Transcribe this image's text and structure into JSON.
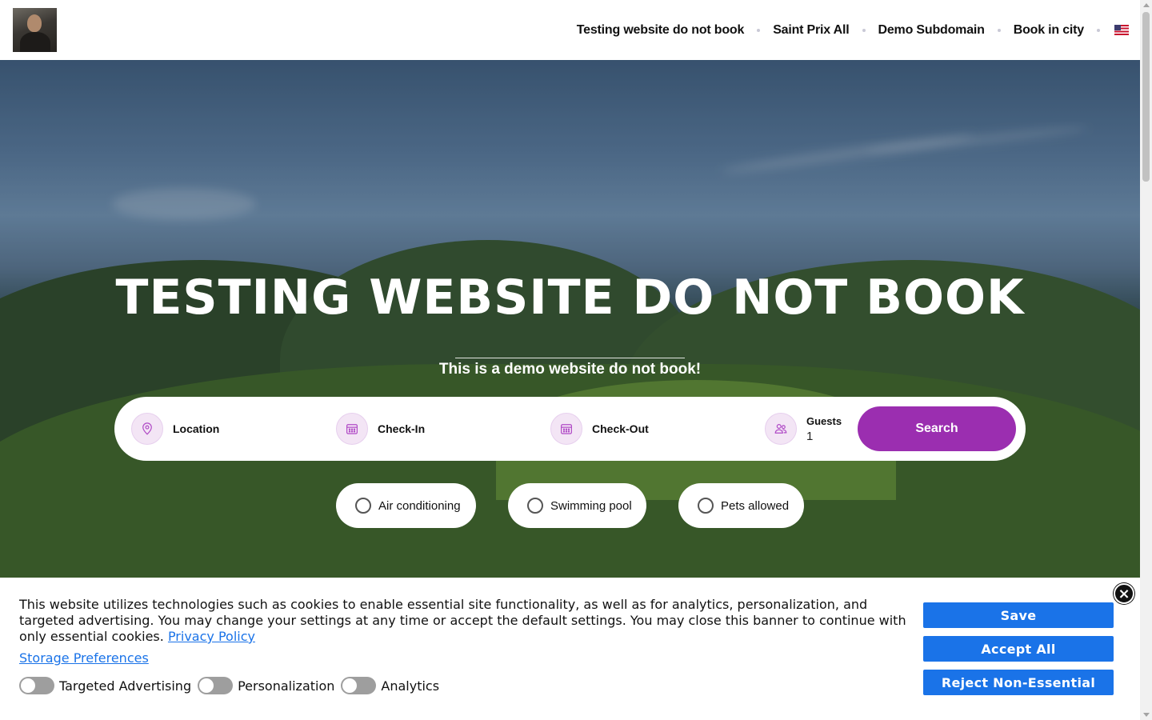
{
  "header": {
    "nav": [
      "Testing website do not book",
      "Saint Prix All",
      "Demo Subdomain",
      "Book in city"
    ],
    "language_icon": "us-flag-icon"
  },
  "hero": {
    "title": "TESTING WEBSITE DO NOT BOOK",
    "subtitle": "This is a demo website do not book!"
  },
  "search": {
    "location_label": "Location",
    "checkin_label": "Check-In",
    "checkout_label": "Check-Out",
    "guests_label": "Guests",
    "guests_value": "1",
    "button_label": "Search",
    "accent_color": "#9b2eb0"
  },
  "amenities": [
    "Air conditioning",
    "Swimming pool",
    "Pets allowed"
  ],
  "cookie_banner": {
    "text": "This website utilizes technologies such as cookies to enable essential site functionality, as well as for analytics, personalization, and targeted advertising. You may change your settings at any time or accept the default settings. You may close this banner to continue with only essential cookies.",
    "privacy_link": "Privacy Policy",
    "preferences_link": "Storage Preferences",
    "toggles": [
      "Targeted Advertising",
      "Personalization",
      "Analytics"
    ],
    "buttons": {
      "save": "Save",
      "accept_all": "Accept All",
      "reject": "Reject Non-Essential"
    },
    "close_icon": "×",
    "button_color": "#1a73e8"
  }
}
